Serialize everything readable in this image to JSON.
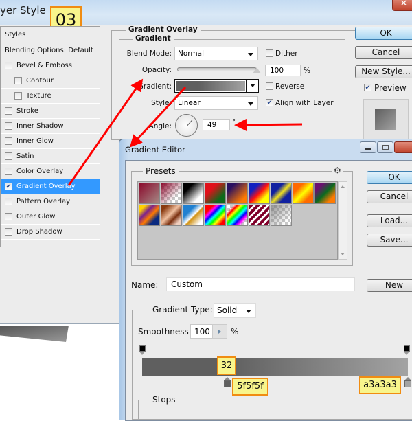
{
  "layer_style": {
    "title": "yer Style",
    "step_badge": "03",
    "styles_panel": {
      "header": "Styles",
      "blending": "Blending Options: Default",
      "items": [
        {
          "label": "Bevel & Emboss",
          "checked": false,
          "indent": false
        },
        {
          "label": "Contour",
          "checked": false,
          "indent": true
        },
        {
          "label": "Texture",
          "checked": false,
          "indent": true
        },
        {
          "label": "Stroke",
          "checked": false,
          "indent": false
        },
        {
          "label": "Inner Shadow",
          "checked": false,
          "indent": false
        },
        {
          "label": "Inner Glow",
          "checked": false,
          "indent": false
        },
        {
          "label": "Satin",
          "checked": false,
          "indent": false
        },
        {
          "label": "Color Overlay",
          "checked": false,
          "indent": false
        },
        {
          "label": "Gradient Overlay",
          "checked": true,
          "indent": false,
          "selected": true
        },
        {
          "label": "Pattern Overlay",
          "checked": false,
          "indent": false
        },
        {
          "label": "Outer Glow",
          "checked": false,
          "indent": false
        },
        {
          "label": "Drop Shadow",
          "checked": false,
          "indent": false
        }
      ]
    },
    "gradient_overlay": {
      "section_title": "Gradient Overlay",
      "group_title": "Gradient",
      "blend_mode_label": "Blend Mode:",
      "blend_mode_value": "Normal",
      "dither_label": "Dither",
      "dither_checked": false,
      "opacity_label": "Opacity:",
      "opacity_value": "100",
      "opacity_percent": 100,
      "percent_sign": "%",
      "gradient_label": "Gradient:",
      "reverse_label": "Reverse",
      "reverse_checked": false,
      "style_label": "Style:",
      "style_value": "Linear",
      "align_label": "Align with Layer",
      "align_checked": true,
      "angle_label": "Angle:",
      "angle_value": "49",
      "degree_sign": "°"
    },
    "buttons": {
      "ok": "OK",
      "cancel": "Cancel",
      "new_style": "New Style...",
      "preview_label": "Preview",
      "preview_checked": true
    }
  },
  "gradient_editor": {
    "title": "Gradient Editor",
    "presets_label": "Presets",
    "gear_icon": "⚙",
    "buttons": {
      "ok": "OK",
      "cancel": "Cancel",
      "load": "Load...",
      "save": "Save...",
      "new": "New"
    },
    "name_label": "Name:",
    "name_value": "Custom",
    "gradient_type_label": "Gradient Type:",
    "gradient_type_value": "Solid",
    "smoothness_label": "Smoothness:",
    "smoothness_value": "100",
    "smoothness_percent": "%",
    "stops_label": "Stops",
    "color_stops": [
      {
        "color": "#5f5f5f",
        "location_percent": 32,
        "label": "5f5f5f"
      },
      {
        "color": "#a3a3a3",
        "location_percent": 100,
        "label": "a3a3a3"
      }
    ],
    "midpoint_badge": "32",
    "presets": [
      "linear-gradient(135deg,#8b0a2c,#a58a86)",
      "checker-red",
      "linear-gradient(135deg,#000 25%,#fff 75%)",
      "linear-gradient(135deg,#e0101a 30%,#0c6a1a 75%)",
      "linear-gradient(135deg,#2a1060 20%,#ff7a00 80%)",
      "linear-gradient(135deg,#1020c0 25%,#ff1010 50%,#ffff00 75%)",
      "linear-gradient(135deg,#1020a0 30%,#f0e020 50%,#1020a0 70%)",
      "linear-gradient(135deg,#ff6a00 25%,#ffff00 50%,#ff6a00 75%)",
      "linear-gradient(135deg,#6a1070 20%,#0a6a20 50%,#ff7a00 80%)",
      "linear-gradient(135deg,#ffd000 15%,#7a2090 35%,#ff7a00 55%,#0a2a80 75%)",
      "linear-gradient(135deg,#8a3a10 15%,#f0c0a0 45%,#7a3010 65%,#f0d0c0 85%)",
      "linear-gradient(135deg,#2080d0 30%,#fff 50%,#d09010 55%,#fff 85%)",
      "linear-gradient(135deg,#ff0000 20%,#ff00ff 30%,#0000ff 40%,#00ffff 50%,#00ff00 60%,#ffff00 70%,#ff0000 85%)",
      "checker-rainbow",
      "repeating-linear-gradient(135deg,#80002a 0 4px,#fff 4px 7px)",
      "checker-grey"
    ]
  }
}
